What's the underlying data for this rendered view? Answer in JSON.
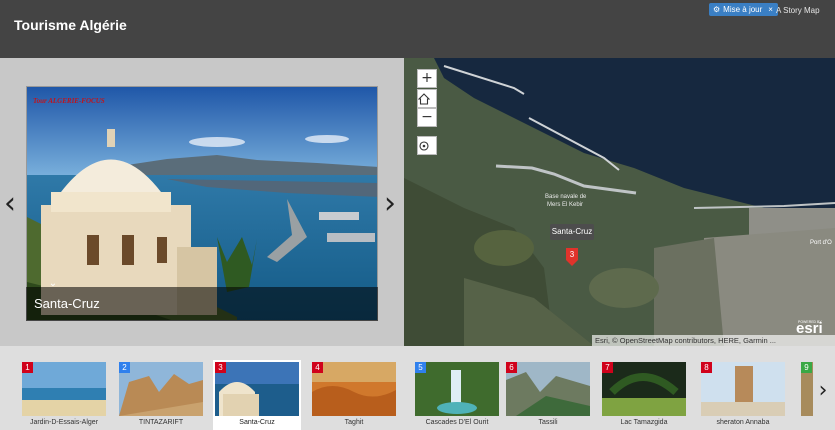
{
  "header": {
    "title": "Tourisme Algérie",
    "update_badge": "Mise à jour",
    "update_close": "×",
    "storymap_link": "A Story Map"
  },
  "media": {
    "caption": "Santa-Cruz",
    "watermark": "Tour ALGERIE-FOCUS",
    "prev_arrow": "‹",
    "next_arrow": "›",
    "collapse_icon": "chevron-down-icon"
  },
  "map": {
    "zoom_in": "+",
    "zoom_out": "−",
    "popup_label": "Santa-Cruz",
    "marker_number": "3",
    "attribution": "Esri, © OpenStreetMap contributors, HERE, Garmin ...",
    "logo": "esri",
    "logo_powered": "POWERED BY",
    "place_labels": [
      "Base navale de Mers El Kebir",
      "Port d'O"
    ],
    "colors": {
      "sea": "#14263d",
      "land": "#4b5a45",
      "marker": "#e0332b"
    }
  },
  "thumbnails": {
    "next_arrow": "›",
    "items": [
      {
        "number": "1",
        "label": "Jardin-D-Essais-Alger",
        "color": "#d0021b",
        "active": false
      },
      {
        "number": "2",
        "label": "TINTAZARIFT",
        "color": "#2f80ed",
        "active": false
      },
      {
        "number": "3",
        "label": "Santa-Cruz",
        "color": "#d0021b",
        "active": true
      },
      {
        "number": "4",
        "label": "Taghit",
        "color": "#d0021b",
        "active": false
      },
      {
        "number": "5",
        "label": "Cascades D'El Ourit",
        "color": "#2f80ed",
        "active": false
      },
      {
        "number": "6",
        "label": "Tassili",
        "color": "#d0021b",
        "active": false
      },
      {
        "number": "7",
        "label": "Lac Tamazgida",
        "color": "#d0021b",
        "active": false
      },
      {
        "number": "8",
        "label": "sheraton Annaba",
        "color": "#d0021b",
        "active": false
      },
      {
        "number": "9",
        "label": "",
        "color": "#3aa845",
        "active": false
      }
    ]
  }
}
